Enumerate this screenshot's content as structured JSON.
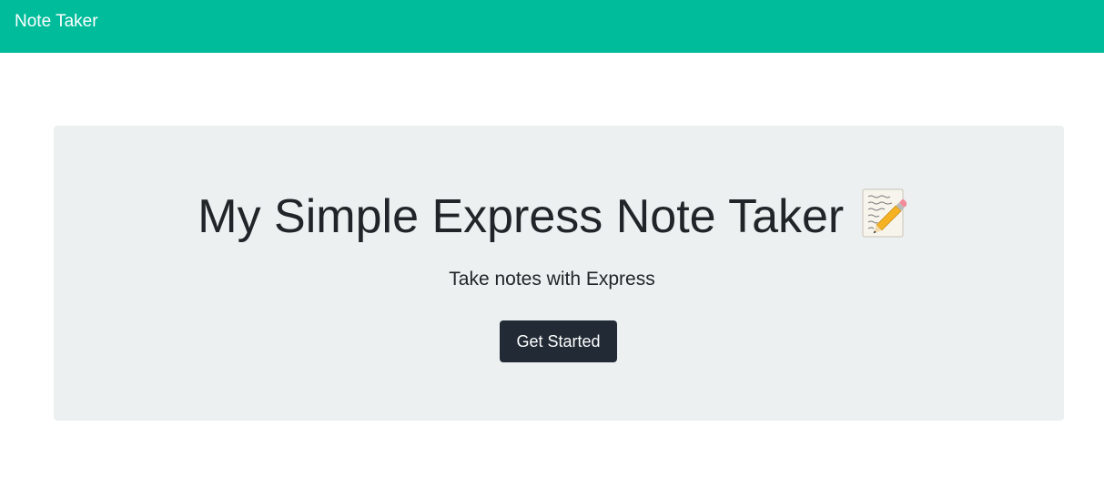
{
  "navbar": {
    "brand": "Note Taker",
    "background_color": "#00bc9b"
  },
  "hero": {
    "title": "My Simple Express Note Taker",
    "title_icon": "memo-pencil-icon",
    "subtitle": "Take notes with Express",
    "button_label": "Get Started",
    "button_color": "#212a35",
    "background_color": "#ecf0f1"
  }
}
